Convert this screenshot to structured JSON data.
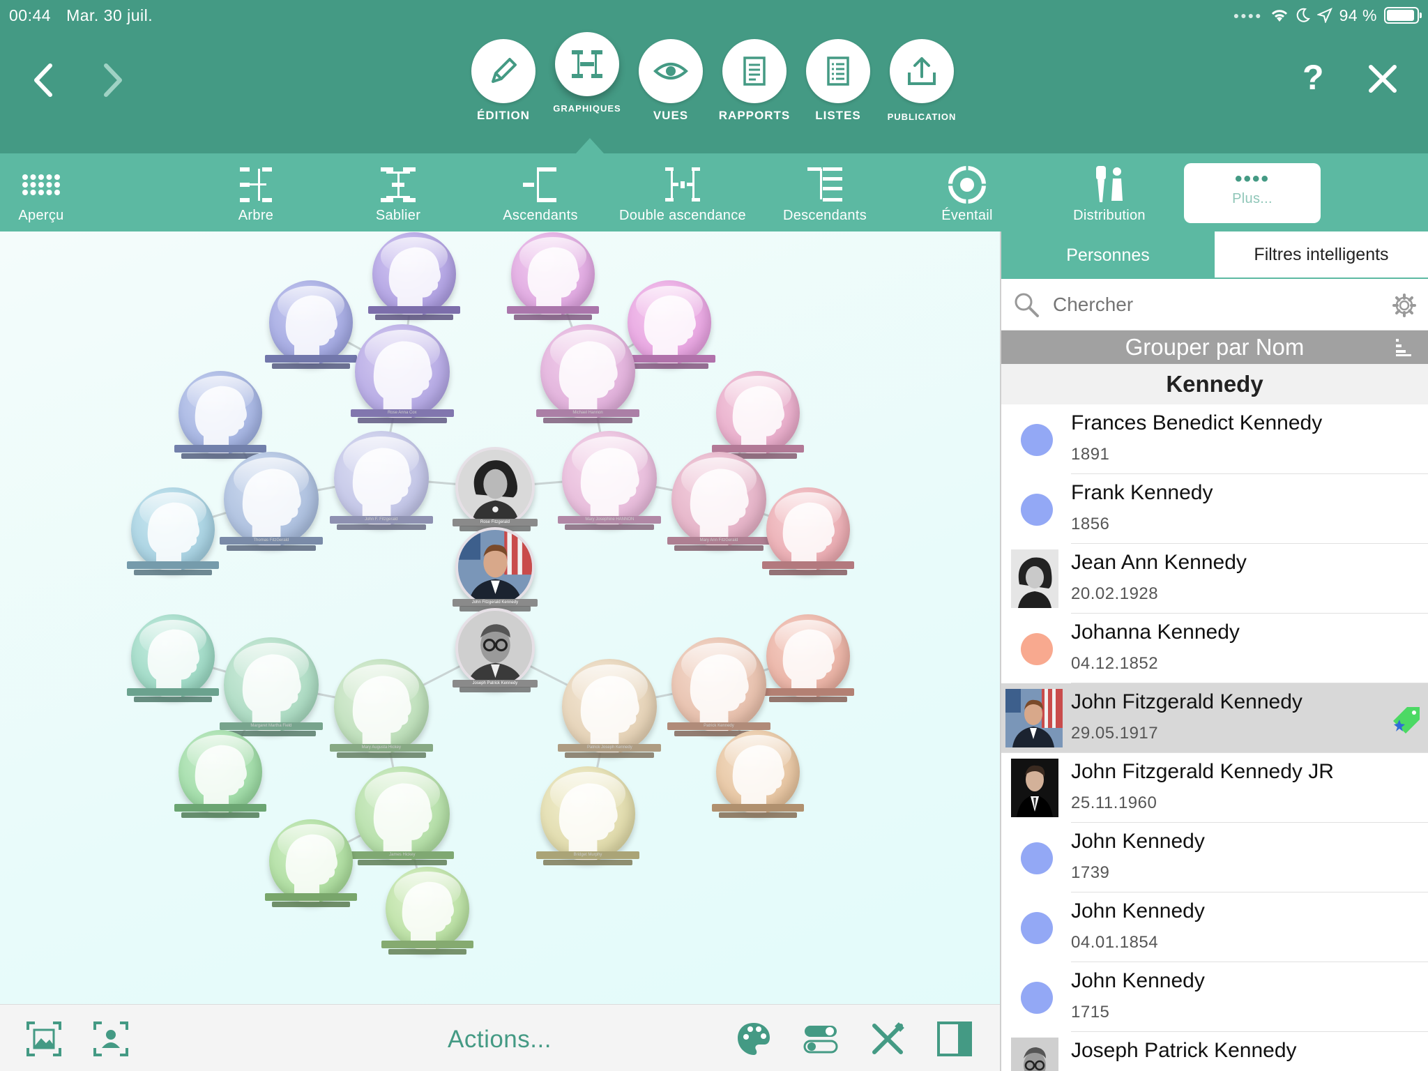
{
  "status": {
    "time": "00:44",
    "date": "Mar. 30 juil.",
    "battery_text": "94 %",
    "battery_level": 0.94
  },
  "main_buttons": [
    {
      "label": "ÉDITION",
      "icon": "pencil-icon"
    },
    {
      "label": "GRAPHIQUES",
      "icon": "chart-tree-icon",
      "active": true
    },
    {
      "label": "VUES",
      "icon": "eye-icon"
    },
    {
      "label": "RAPPORTS",
      "icon": "report-icon"
    },
    {
      "label": "LISTES",
      "icon": "list-icon"
    },
    {
      "label": "PUBLICATION",
      "icon": "upload-icon"
    }
  ],
  "help_label": "?",
  "chart_types": [
    {
      "label": "Aperçu",
      "icon": "grid-dots-icon"
    },
    {
      "label": "Arbre",
      "icon": "tree-chart-icon"
    },
    {
      "label": "Sablier",
      "icon": "hourglass-chart-icon"
    },
    {
      "label": "Ascendants",
      "icon": "ancestors-chart-icon"
    },
    {
      "label": "Double ascendance",
      "icon": "double-ancestry-icon"
    },
    {
      "label": "Descendants",
      "icon": "descendants-chart-icon"
    },
    {
      "label": "Éventail",
      "icon": "fan-chart-icon"
    },
    {
      "label": "Distribution",
      "icon": "distribution-chart-icon"
    },
    {
      "label": "Plus...",
      "icon": "more-dots-icon",
      "selected": true
    }
  ],
  "chart": {
    "center_names": [
      "Rose Fitzgerald",
      "John Fitzgerald Kennedy",
      "Joseph Patrick Kennedy"
    ],
    "node_names": {
      "rose_anna_cox": "Rose Anna Cox",
      "michael_hannon": "Michael Hannon",
      "thomas_fitzgerald": "Thomas FitzGerald",
      "john_f_fitzgerald": "John F. Fitzgerald",
      "mary_josephine_hannon": "Mary Josephine HANNON",
      "mary_ann_fitzgerald": "Mary Ann FitzGerald",
      "margaret_martha_field": "Margaret Martha Field",
      "mary_augusta_hickey": "Mary Augusta Hickey",
      "patrick_joseph_kennedy": "Patrick Joseph Kennedy",
      "patrick_kennedy": "Patrick Kennedy",
      "james_hickey": "James Hickey",
      "bridget_murphy": "Bridget Murphy"
    }
  },
  "bottom": {
    "actions_label": "Actions..."
  },
  "panel": {
    "tabs": [
      "Personnes",
      "Filtres intelligents"
    ],
    "search_placeholder": "Chercher",
    "group_by_label": "Grouper par Nom",
    "group_header": "Kennedy",
    "persons": [
      {
        "name": "Frances Benedict Kennedy",
        "date": "1891",
        "marker": "dot",
        "color": "#93a8f5"
      },
      {
        "name": "Frank Kennedy",
        "date": "1856",
        "marker": "dot",
        "color": "#93a8f5"
      },
      {
        "name": "Jean Ann Kennedy",
        "date": "20.02.1928",
        "marker": "photo"
      },
      {
        "name": "Johanna Kennedy",
        "date": "04.12.1852",
        "marker": "dot",
        "color": "#f8a98f"
      },
      {
        "name": "John Fitzgerald Kennedy",
        "date": "29.05.1917",
        "marker": "photo",
        "selected": true
      },
      {
        "name": "John Fitzgerald Kennedy JR",
        "date": "25.11.1960",
        "marker": "photo"
      },
      {
        "name": "John Kennedy",
        "date": "1739",
        "marker": "dot",
        "color": "#93a8f5"
      },
      {
        "name": "John Kennedy",
        "date": "04.01.1854",
        "marker": "dot",
        "color": "#93a8f5"
      },
      {
        "name": "John Kennedy",
        "date": "1715",
        "marker": "dot",
        "color": "#93a8f5"
      },
      {
        "name": "Joseph Patrick Kennedy",
        "date": "",
        "marker": "photo"
      }
    ]
  },
  "colors": {
    "header": "#449a84",
    "strip": "#5cb9a2",
    "accent": "#449a84"
  }
}
